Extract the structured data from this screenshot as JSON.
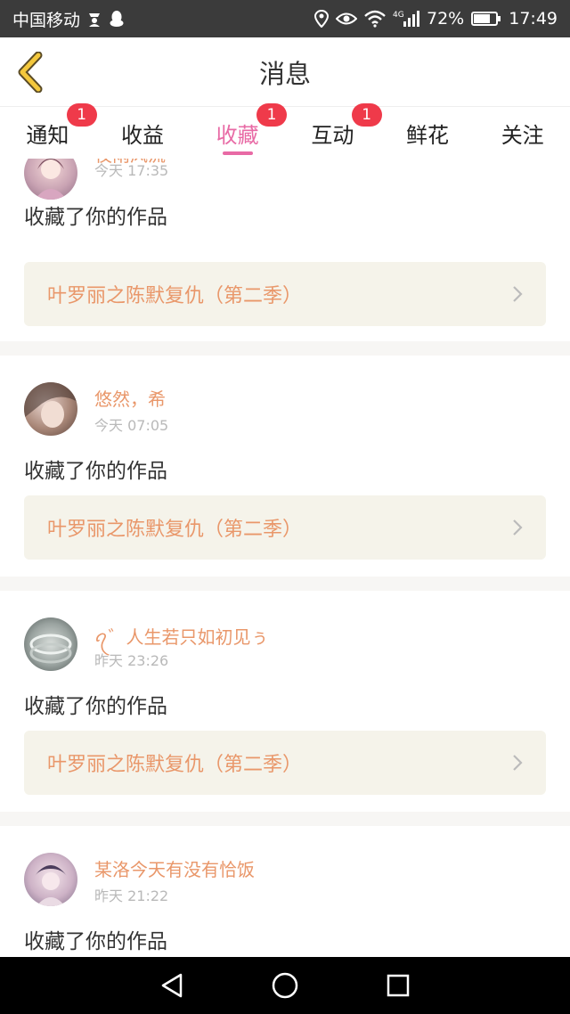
{
  "status_bar": {
    "carrier": "中国移动",
    "network": "4G",
    "battery": "72%",
    "time": "17:49",
    "icons": [
      "guest-icon",
      "qq-penguin-icon",
      "location-icon",
      "eye-icon",
      "wifi-icon",
      "signal-icon",
      "battery-icon"
    ]
  },
  "header": {
    "title": "消息",
    "back_icon": "chevron-left-icon"
  },
  "tabs": [
    {
      "label": "通知",
      "badge": "1",
      "active": false
    },
    {
      "label": "收益",
      "badge": "",
      "active": false
    },
    {
      "label": "收藏",
      "badge": "1",
      "active": true
    },
    {
      "label": "互动",
      "badge": "1",
      "active": false
    },
    {
      "label": "鲜花",
      "badge": "",
      "active": false
    },
    {
      "label": "关注",
      "badge": "",
      "active": false
    }
  ],
  "colors": {
    "accent_pink": "#e86aa5",
    "username_orange": "#e9976a",
    "badge_red": "#ef3a4a",
    "card_link_bg": "#f5f3ea"
  },
  "messages": [
    {
      "username": "夜雨风流",
      "time": "今天 17:35",
      "action": "收藏了你的作品",
      "work_title": "叶罗丽之陈默复仇（第二季）"
    },
    {
      "username": "悠然，希",
      "time": "今天 07:05",
      "action": "收藏了你的作品",
      "work_title": "叶罗丽之陈默复仇（第二季）"
    },
    {
      "username": "ꪖ゛人生若只如初见ぅ",
      "time": "昨天 23:26",
      "action": "收藏了你的作品",
      "work_title": "叶罗丽之陈默复仇（第二季）"
    },
    {
      "username": "某洛今天有没有恰饭",
      "time": "昨天 21:22",
      "action": "收藏了你的作品",
      "work_title": ""
    }
  ],
  "bottom_nav": [
    "back-triangle-icon",
    "home-circle-icon",
    "recents-square-icon"
  ]
}
